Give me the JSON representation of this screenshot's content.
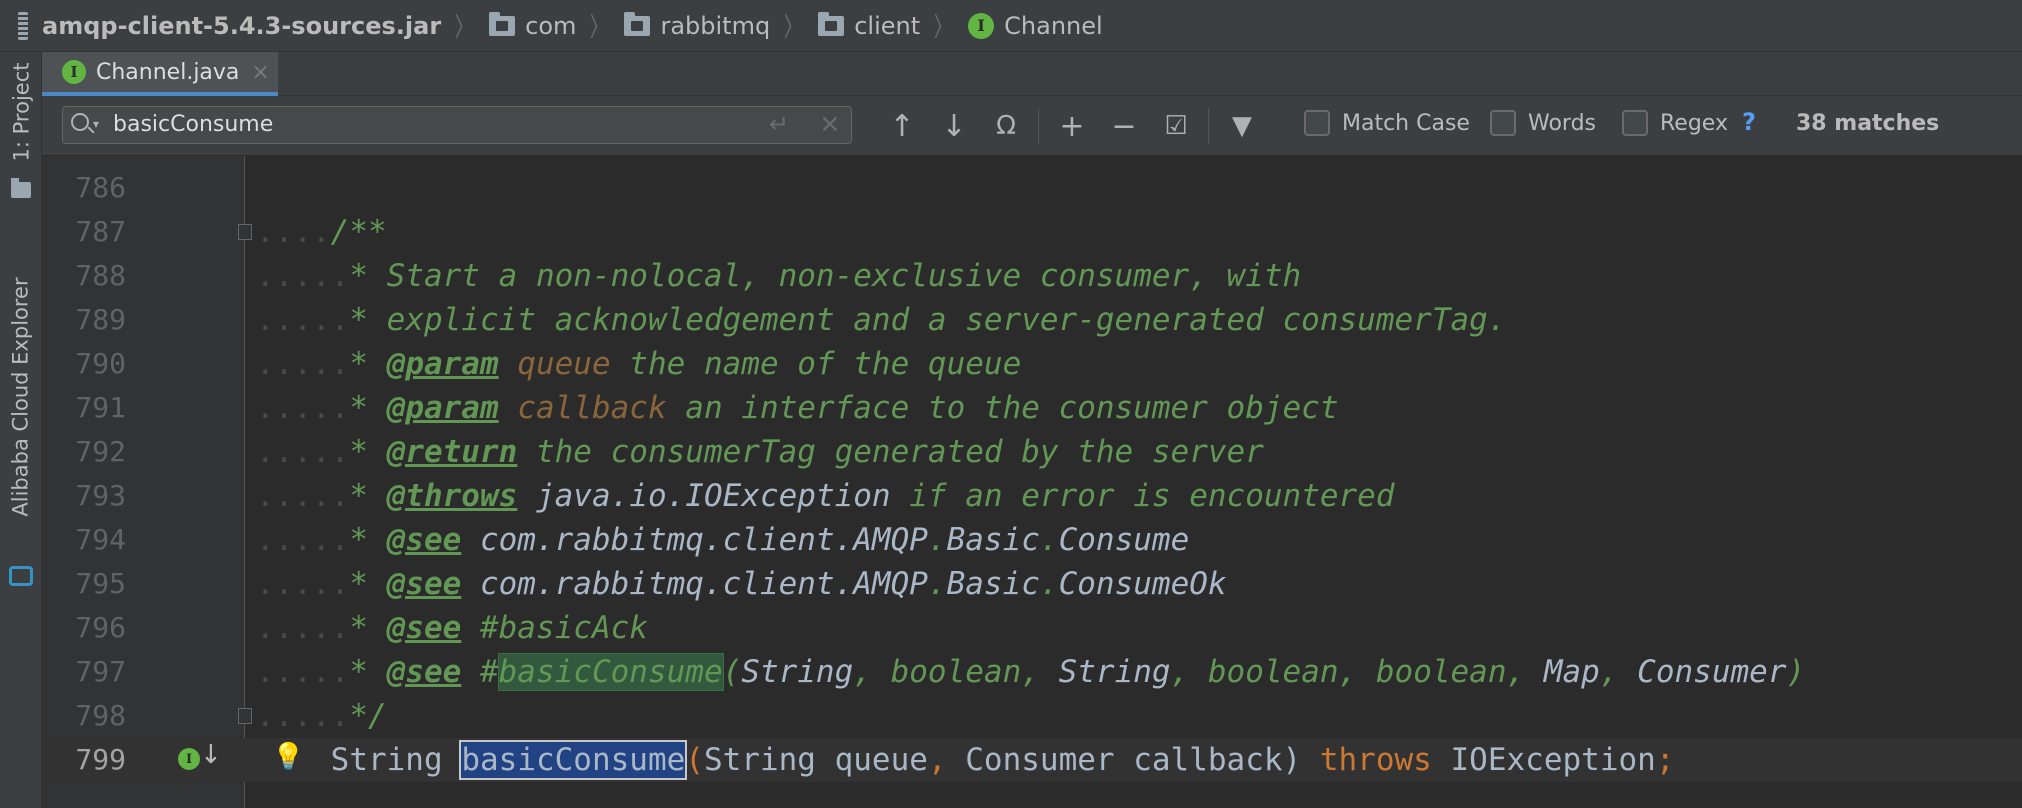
{
  "breadcrumb": {
    "items": [
      {
        "label": "amqp-client-5.4.3-sources.jar",
        "icon": "jar-icon"
      },
      {
        "label": "com",
        "icon": "folder-icon"
      },
      {
        "label": "rabbitmq",
        "icon": "folder-icon"
      },
      {
        "label": "client",
        "icon": "folder-icon"
      },
      {
        "label": "Channel",
        "icon": "interface-icon",
        "icon_glyph": "I"
      }
    ]
  },
  "tool_stripe": {
    "project_tab": "1: Project",
    "cloud_tab": "Alibaba Cloud Explorer"
  },
  "editor_tab": {
    "label": "Channel.java",
    "icon_glyph": "I",
    "close": "×"
  },
  "search": {
    "query": "basicConsume",
    "enter_glyph": "↵",
    "clear_glyph": "×",
    "prev_glyph": "↑",
    "next_glyph": "↓",
    "select_all_glyph": "Ω",
    "add_glyph": "+",
    "remove_glyph": "−",
    "check_glyph": "☑",
    "filter_glyph": "▼",
    "match_case": "Match Case",
    "words": "Words",
    "regex": "Regex",
    "help": "?",
    "matches": "38 matches"
  },
  "colors": {
    "background": "#2b2b2b",
    "comment": "#629755",
    "keyword": "#cc7832",
    "param_name": "#8a653b",
    "match_highlight": "#32593d",
    "current_match": "#214283",
    "interface_green": "#62b543"
  },
  "code": {
    "lines": [
      {
        "n": "786",
        "dots": "",
        "segs": []
      },
      {
        "n": "787",
        "dots": "....",
        "segs": [
          {
            "t": "/**",
            "c": "cmt"
          }
        ]
      },
      {
        "n": "788",
        "dots": ".....",
        "segs": [
          {
            "t": "* Start a non-nolocal, non-exclusive consumer, with",
            "c": "cmt"
          }
        ]
      },
      {
        "n": "789",
        "dots": ".....",
        "segs": [
          {
            "t": "* explicit acknowledgement and a server-generated consumerTag.",
            "c": "cmt"
          }
        ]
      },
      {
        "n": "790",
        "dots": ".....",
        "segs": [
          {
            "t": "* ",
            "c": "cmt"
          },
          {
            "t": "@param",
            "c": "tag"
          },
          {
            "t": " ",
            "c": "cmt"
          },
          {
            "t": "queue",
            "c": "pname"
          },
          {
            "t": " the name of the queue",
            "c": "cmt"
          }
        ]
      },
      {
        "n": "791",
        "dots": ".....",
        "segs": [
          {
            "t": "* ",
            "c": "cmt"
          },
          {
            "t": "@param",
            "c": "tag"
          },
          {
            "t": " ",
            "c": "cmt"
          },
          {
            "t": "callback",
            "c": "pname"
          },
          {
            "t": " an interface to the consumer object",
            "c": "cmt"
          }
        ]
      },
      {
        "n": "792",
        "dots": ".....",
        "segs": [
          {
            "t": "* ",
            "c": "cmt"
          },
          {
            "t": "@return",
            "c": "tag"
          },
          {
            "t": " the consumerTag generated by the server",
            "c": "cmt"
          }
        ]
      },
      {
        "n": "793",
        "dots": ".....",
        "segs": [
          {
            "t": "* ",
            "c": "cmt"
          },
          {
            "t": "@throws",
            "c": "tag"
          },
          {
            "t": " ",
            "c": "cmt"
          },
          {
            "t": "java.io.IOException",
            "c": "ref"
          },
          {
            "t": " if an error is encountered",
            "c": "cmt"
          }
        ]
      },
      {
        "n": "794",
        "dots": ".....",
        "segs": [
          {
            "t": "* ",
            "c": "cmt"
          },
          {
            "t": "@see",
            "c": "tag"
          },
          {
            "t": " ",
            "c": "cmt"
          },
          {
            "t": "com.rabbitmq.client.AMQP",
            "c": "ref"
          },
          {
            "t": ".",
            "c": "cmt"
          },
          {
            "t": "Basic",
            "c": "ref"
          },
          {
            "t": ".",
            "c": "cmt"
          },
          {
            "t": "Consume",
            "c": "ref"
          }
        ]
      },
      {
        "n": "795",
        "dots": ".....",
        "segs": [
          {
            "t": "* ",
            "c": "cmt"
          },
          {
            "t": "@see",
            "c": "tag"
          },
          {
            "t": " ",
            "c": "cmt"
          },
          {
            "t": "com.rabbitmq.client.AMQP",
            "c": "ref"
          },
          {
            "t": ".",
            "c": "cmt"
          },
          {
            "t": "Basic",
            "c": "ref"
          },
          {
            "t": ".",
            "c": "cmt"
          },
          {
            "t": "ConsumeOk",
            "c": "ref"
          }
        ]
      },
      {
        "n": "796",
        "dots": ".....",
        "segs": [
          {
            "t": "* ",
            "c": "cmt"
          },
          {
            "t": "@see",
            "c": "tag"
          },
          {
            "t": " #basicAck",
            "c": "cmt"
          }
        ]
      },
      {
        "n": "797",
        "dots": ".....",
        "segs": [
          {
            "t": "* ",
            "c": "cmt"
          },
          {
            "t": "@see",
            "c": "tag"
          },
          {
            "t": " #",
            "c": "cmt"
          },
          {
            "t": "basicConsume",
            "c": "cmt hl-match"
          },
          {
            "t": "(",
            "c": "cmt"
          },
          {
            "t": "String",
            "c": "ref"
          },
          {
            "t": ", boolean, ",
            "c": "cmt"
          },
          {
            "t": "String",
            "c": "ref"
          },
          {
            "t": ", boolean, boolean, ",
            "c": "cmt"
          },
          {
            "t": "Map",
            "c": "ref"
          },
          {
            "t": ", ",
            "c": "cmt"
          },
          {
            "t": "Consumer",
            "c": "ref"
          },
          {
            "t": ")",
            "c": "cmt"
          }
        ]
      },
      {
        "n": "798",
        "dots": ".....",
        "segs": [
          {
            "t": "*/",
            "c": "cmt"
          }
        ]
      },
      {
        "n": "799",
        "dots": "    ",
        "segs": [
          {
            "t": "String ",
            "c": "ty"
          },
          {
            "t": "basicConsume",
            "c": "ty hl-cur"
          },
          {
            "t": "(",
            "c": "kw"
          },
          {
            "t": "String queue",
            "c": "ty"
          },
          {
            "t": ", ",
            "c": "kw"
          },
          {
            "t": "Consumer callback",
            "c": "ty"
          },
          {
            "t": ") ",
            "c": "ty"
          },
          {
            "t": "throws",
            "c": "kw"
          },
          {
            "t": " IOException",
            "c": "ty"
          },
          {
            "t": ";",
            "c": "kw"
          }
        ]
      }
    ]
  }
}
